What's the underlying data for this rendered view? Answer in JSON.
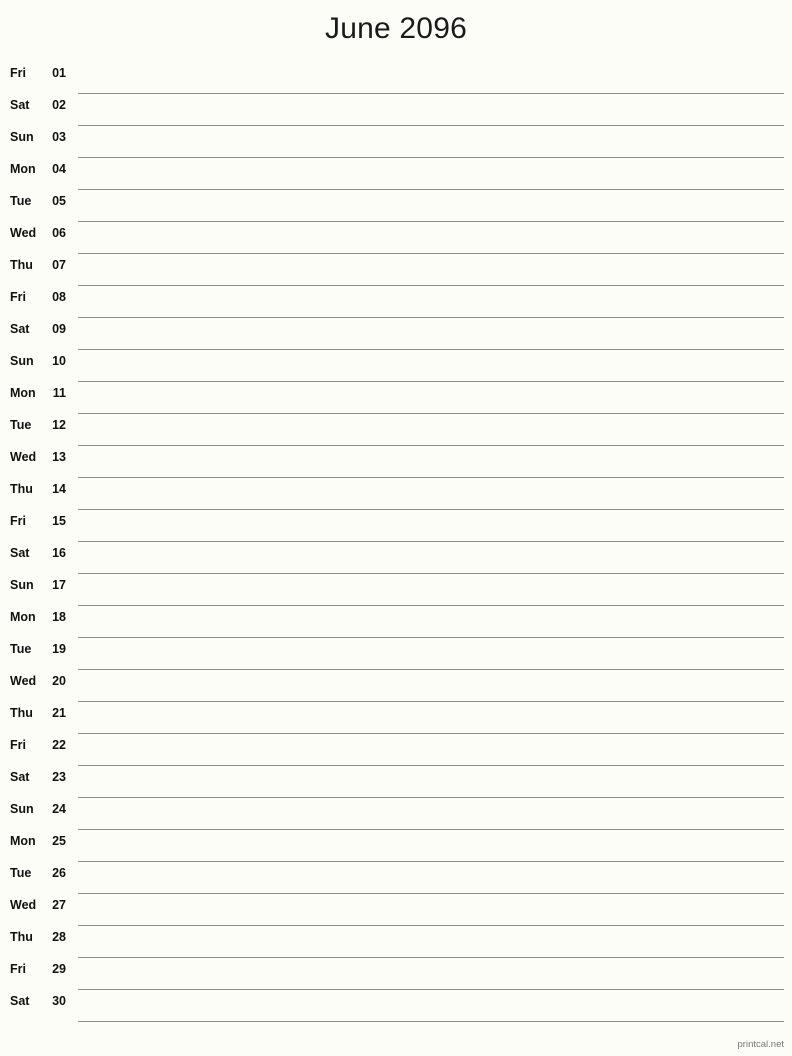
{
  "document": {
    "title": "June 2096",
    "type": "printable-monthly-calendar",
    "footer": "printcal.net"
  },
  "calendar": {
    "month": "June",
    "year": "2096",
    "days": [
      {
        "dow": "Fri",
        "num": "01"
      },
      {
        "dow": "Sat",
        "num": "02"
      },
      {
        "dow": "Sun",
        "num": "03"
      },
      {
        "dow": "Mon",
        "num": "04"
      },
      {
        "dow": "Tue",
        "num": "05"
      },
      {
        "dow": "Wed",
        "num": "06"
      },
      {
        "dow": "Thu",
        "num": "07"
      },
      {
        "dow": "Fri",
        "num": "08"
      },
      {
        "dow": "Sat",
        "num": "09"
      },
      {
        "dow": "Sun",
        "num": "10"
      },
      {
        "dow": "Mon",
        "num": "11"
      },
      {
        "dow": "Tue",
        "num": "12"
      },
      {
        "dow": "Wed",
        "num": "13"
      },
      {
        "dow": "Thu",
        "num": "14"
      },
      {
        "dow": "Fri",
        "num": "15"
      },
      {
        "dow": "Sat",
        "num": "16"
      },
      {
        "dow": "Sun",
        "num": "17"
      },
      {
        "dow": "Mon",
        "num": "18"
      },
      {
        "dow": "Tue",
        "num": "19"
      },
      {
        "dow": "Wed",
        "num": "20"
      },
      {
        "dow": "Thu",
        "num": "21"
      },
      {
        "dow": "Fri",
        "num": "22"
      },
      {
        "dow": "Sat",
        "num": "23"
      },
      {
        "dow": "Sun",
        "num": "24"
      },
      {
        "dow": "Mon",
        "num": "25"
      },
      {
        "dow": "Tue",
        "num": "26"
      },
      {
        "dow": "Wed",
        "num": "27"
      },
      {
        "dow": "Thu",
        "num": "28"
      },
      {
        "dow": "Fri",
        "num": "29"
      },
      {
        "dow": "Sat",
        "num": "30"
      }
    ]
  },
  "colors": {
    "background": "#fdfdf8",
    "text": "#111111",
    "rule": "#8b8f88",
    "footer_text": "#777777"
  }
}
